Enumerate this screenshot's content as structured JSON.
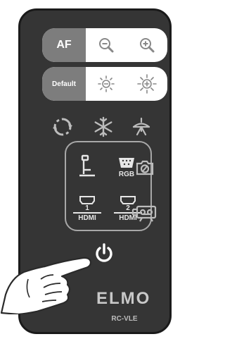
{
  "remote": {
    "af_label": "AF",
    "default_label": "Default",
    "icons": [
      "zoom-out-icon",
      "zoom-in-icon",
      "brightness-down-icon",
      "brightness-up-icon",
      "rotate-icon",
      "freeze-icon",
      "lamp-icon",
      "camera-input-icon",
      "rgb-input-icon",
      "hdmi1-input-icon",
      "hdmi2-input-icon",
      "capture-icon",
      "record-icon",
      "power-icon"
    ],
    "inputs": {
      "rgb_label": "RGB",
      "hdmi_label": "HDMI",
      "hdmi1_number": "1",
      "hdmi2_number": "2"
    },
    "brand": "ELMO",
    "model": "RC-VLE"
  },
  "colors": {
    "body": "#353535",
    "pill_dark": "#7d7d7d",
    "icon_light": "#e6e6e6",
    "icon_gray": "#bdbdbd"
  }
}
